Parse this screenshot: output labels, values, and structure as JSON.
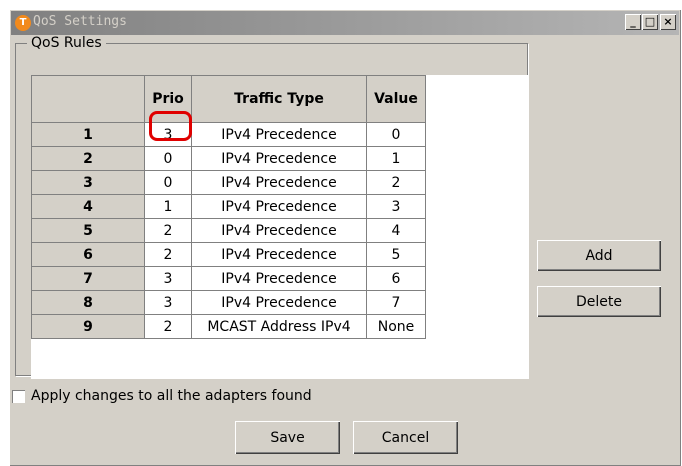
{
  "window": {
    "title": "QoS Settings",
    "icon_letter": "T",
    "minimize": "_",
    "maximize": "□",
    "close": "×"
  },
  "group": {
    "label": "QoS Rules"
  },
  "table": {
    "headers": [
      "",
      "Prio",
      "Traffic Type",
      "Value"
    ],
    "rows": [
      {
        "num": "1",
        "prio": "3",
        "type": "IPv4 Precedence",
        "value": "0"
      },
      {
        "num": "2",
        "prio": "0",
        "type": "IPv4 Precedence",
        "value": "1"
      },
      {
        "num": "3",
        "prio": "0",
        "type": "IPv4 Precedence",
        "value": "2"
      },
      {
        "num": "4",
        "prio": "1",
        "type": "IPv4 Precedence",
        "value": "3"
      },
      {
        "num": "5",
        "prio": "2",
        "type": "IPv4 Precedence",
        "value": "4"
      },
      {
        "num": "6",
        "prio": "2",
        "type": "IPv4 Precedence",
        "value": "5"
      },
      {
        "num": "7",
        "prio": "3",
        "type": "IPv4 Precedence",
        "value": "6"
      },
      {
        "num": "8",
        "prio": "3",
        "type": "IPv4 Precedence",
        "value": "7"
      },
      {
        "num": "9",
        "prio": "2",
        "type": "MCAST Address IPv4",
        "value": "None"
      }
    ]
  },
  "buttons": {
    "add": "Add",
    "delete": "Delete",
    "save": "Save",
    "cancel": "Cancel"
  },
  "apply_all": {
    "label": "Apply changes to all the adapters found",
    "checked": false
  },
  "colors": {
    "highlight": "#e00000",
    "face": "#d4d0c8",
    "title_gradient": "#808080"
  }
}
